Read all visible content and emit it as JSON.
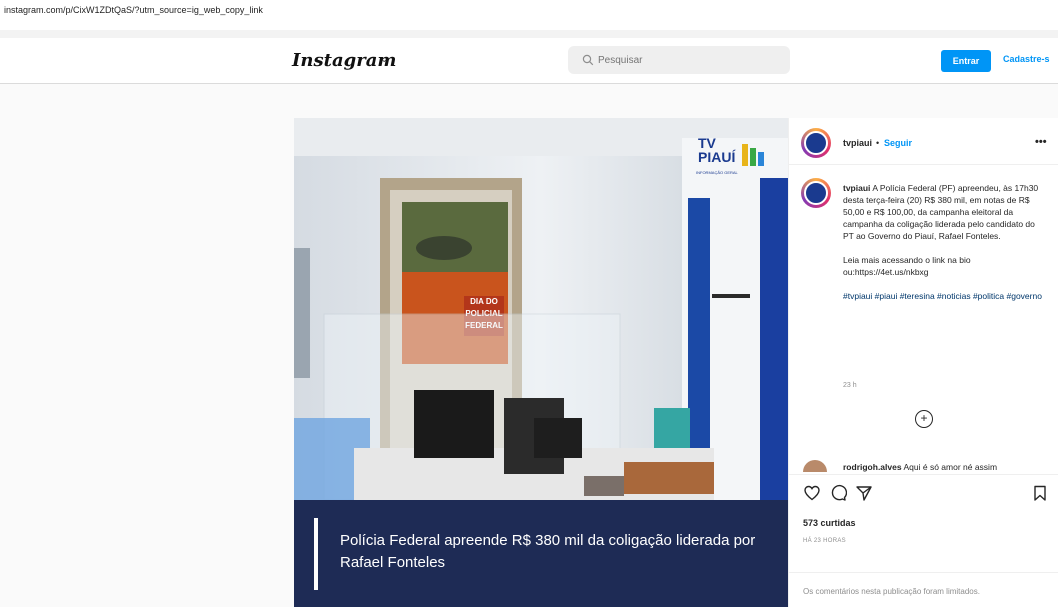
{
  "browser": {
    "url": "instagram.com/p/CixW1ZDtQaS/?utm_source=ig_web_copy_link"
  },
  "nav": {
    "logo": "Instagram",
    "search_placeholder": "Pesquisar",
    "login_label": "Entrar",
    "signup_label": "Cadastre-s"
  },
  "post": {
    "username": "tvpiaui",
    "separator": "•",
    "follow_label": "Seguir",
    "more_label": "•••",
    "caption_user": "tvpiaui",
    "caption_body": "A Polícia Federal (PF) apreendeu, às 17h30 desta terça-feira (20) R$ 380 mil, em notas de R$ 50,00 e R$ 100,00, da campanha eleitoral da campanha da coligação liderada pelo candidato do PT ao Governo do Piauí, Rafael Fonteles.",
    "caption_more": "Leia mais acessando o link na bio ou:https://4et.us/nkbxg",
    "hashtags": "#tvpiaui #piaui #teresina #noticias #politica #governo",
    "caption_time": "23 h",
    "comment_user": "rodrigoh.alves",
    "comment_text": "Aqui é só amor né assim",
    "likes": "573 curtidas",
    "post_time": "HÁ 23 HORAS",
    "comments_disabled": "Os comentários nesta publicação foram limitados."
  },
  "media": {
    "headline": "Polícia Federal apreende R$ 380 mil da coligação liderada por Rafael Fonteles",
    "brand": "TV PIAUÍ",
    "brand_sub": "INFORMAÇÃO GERAL",
    "poster_text": "DIA DO POLICIAL FEDERAL"
  },
  "colors": {
    "accent": "#0095f6",
    "caption_bar": "#1e2b55",
    "brand_blue": "#1a3a8f"
  }
}
